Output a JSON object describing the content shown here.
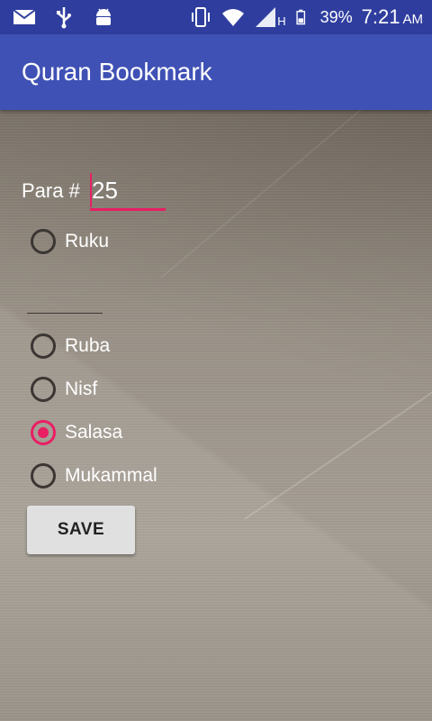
{
  "status_bar": {
    "icons": [
      "mail-icon",
      "usb-icon",
      "android-icon",
      "vibrate-icon",
      "wifi-icon",
      "signal-icon",
      "battery-icon"
    ],
    "network_type": "H",
    "battery_percent": "39%",
    "time": "7:21",
    "ampm": "AM"
  },
  "app_bar": {
    "title": "Quran Bookmark"
  },
  "form": {
    "para_label": "Para #",
    "para_value": "25",
    "options": [
      {
        "label": "Ruku",
        "checked": false
      },
      {
        "label": "Ruba",
        "checked": false
      },
      {
        "label": "Nisf",
        "checked": false
      },
      {
        "label": "Salasa",
        "checked": true
      },
      {
        "label": "Mukammal",
        "checked": false
      }
    ],
    "save_label": "SAVE"
  },
  "colors": {
    "status_bar": "#2f3e9e",
    "app_bar": "#3f51b5",
    "accent": "#e91e63",
    "button": "#e0e0e0"
  }
}
